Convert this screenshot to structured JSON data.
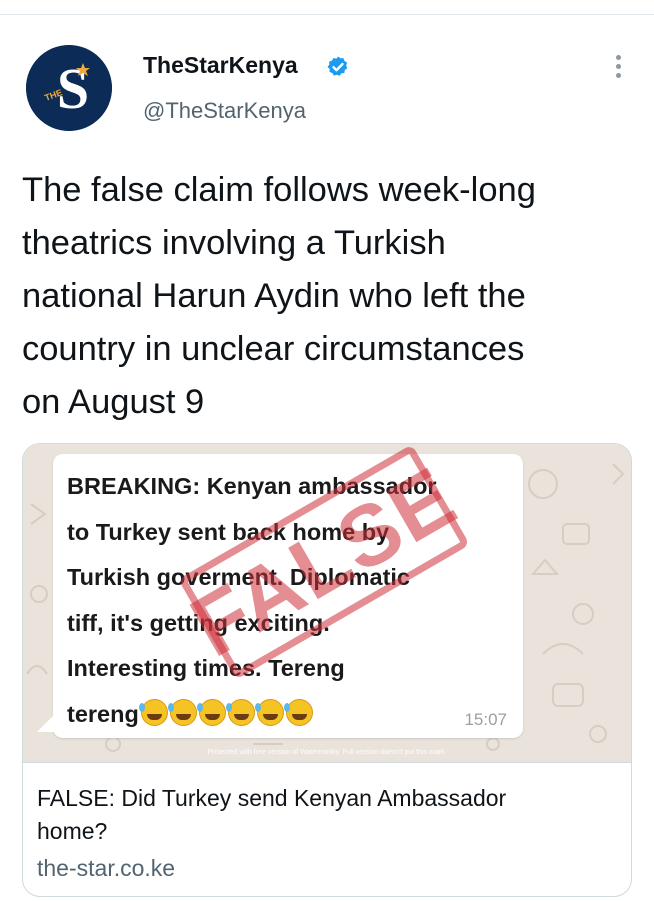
{
  "tweet": {
    "author": {
      "display_name": "TheStarKenya",
      "handle": "@TheStarKenya",
      "avatar_logo_text": "S",
      "avatar_small_text": "THE",
      "verified": true
    },
    "text_lines": [
      "The false claim follows week-long",
      "theatrics involving a Turkish",
      "national Harun Aydin who left the",
      "country in unclear circumstances",
      "on August 9"
    ],
    "more_icon": "more-vertical-icon",
    "card": {
      "image": {
        "message_lines": [
          "BREAKING: Kenyan ambassador",
          "to Turkey sent back home by",
          "Turkish goverment. Diplomatic",
          "tiff, it's getting exciting.",
          "Interesting times. Tereng"
        ],
        "last_line_text": "tereng",
        "emoji": [
          "rolling-on-floor-laughing-emoji",
          "rolling-on-floor-laughing-emoji",
          "rolling-on-floor-laughing-emoji",
          "rolling-on-floor-laughing-emoji",
          "rolling-on-floor-laughing-emoji",
          "rolling-on-floor-laughing-emoji"
        ],
        "time": "15:07",
        "stamp_text": "FALSE",
        "watermark": "Protected with free version of Watermarkly. Full version doesn't put this mark."
      },
      "title_lines": [
        "FALSE: Did Turkey send Kenyan Ambassador",
        "home?"
      ],
      "domain": "the-star.co.ke"
    }
  },
  "colors": {
    "verified_blue": "#1d9bf0",
    "avatar_bg": "#0d2b57",
    "stamp_red": "#ce3038",
    "secondary_text": "#536471"
  }
}
